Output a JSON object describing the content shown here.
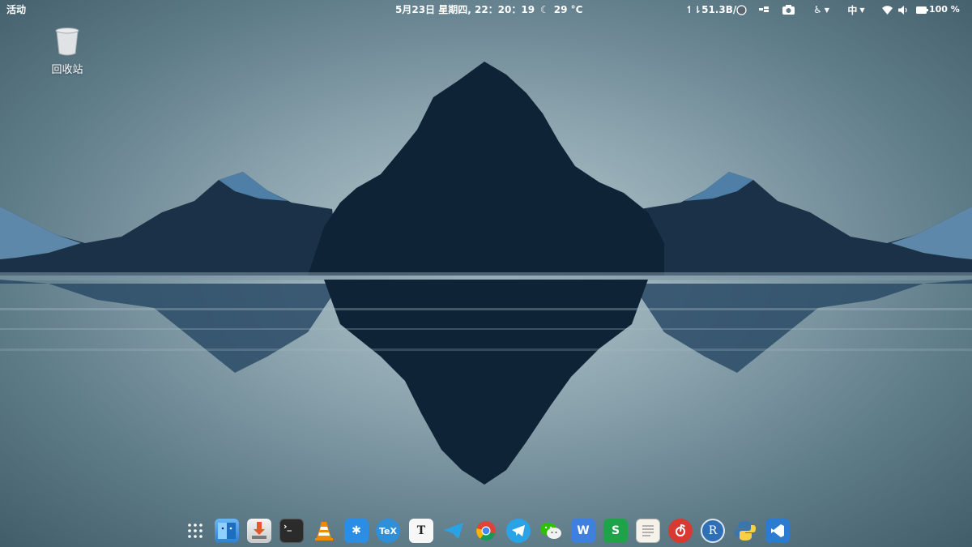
{
  "topbar": {
    "activities_label": "活动",
    "clock": "5月23日 星期四, 22：20：19",
    "weather_temp": "29 °C",
    "net_speed": "↿⇂51.3B/s",
    "input_method": "中",
    "battery_percent": "100 %"
  },
  "desktop": {
    "trash_label": "回收站"
  },
  "dock": {
    "apps": [
      {
        "name": "app-grid",
        "label": "⋮⋮"
      },
      {
        "name": "files",
        "label": ""
      },
      {
        "name": "software-installer",
        "label": ""
      },
      {
        "name": "terminal",
        "label": "›_"
      },
      {
        "name": "vlc",
        "label": ""
      },
      {
        "name": "app-blue-star",
        "label": "✱"
      },
      {
        "name": "texstudio",
        "label": "TeX"
      },
      {
        "name": "typora",
        "label": "T"
      },
      {
        "name": "app-blue-plane",
        "label": ""
      },
      {
        "name": "chrome",
        "label": ""
      },
      {
        "name": "telegram",
        "label": ""
      },
      {
        "name": "wechat",
        "label": ""
      },
      {
        "name": "wps-writer",
        "label": "W"
      },
      {
        "name": "wps-spreadsheet",
        "label": "S"
      },
      {
        "name": "text-editor",
        "label": ""
      },
      {
        "name": "netease-music",
        "label": ""
      },
      {
        "name": "rstudio",
        "label": "R"
      },
      {
        "name": "python",
        "label": ""
      },
      {
        "name": "vscode",
        "label": ""
      }
    ]
  },
  "colors": {
    "mountain": "#0f2336",
    "mountain_light": "#3f6d8f",
    "sky_center": "#b9cbd2",
    "sky_edge": "#425d6a"
  }
}
